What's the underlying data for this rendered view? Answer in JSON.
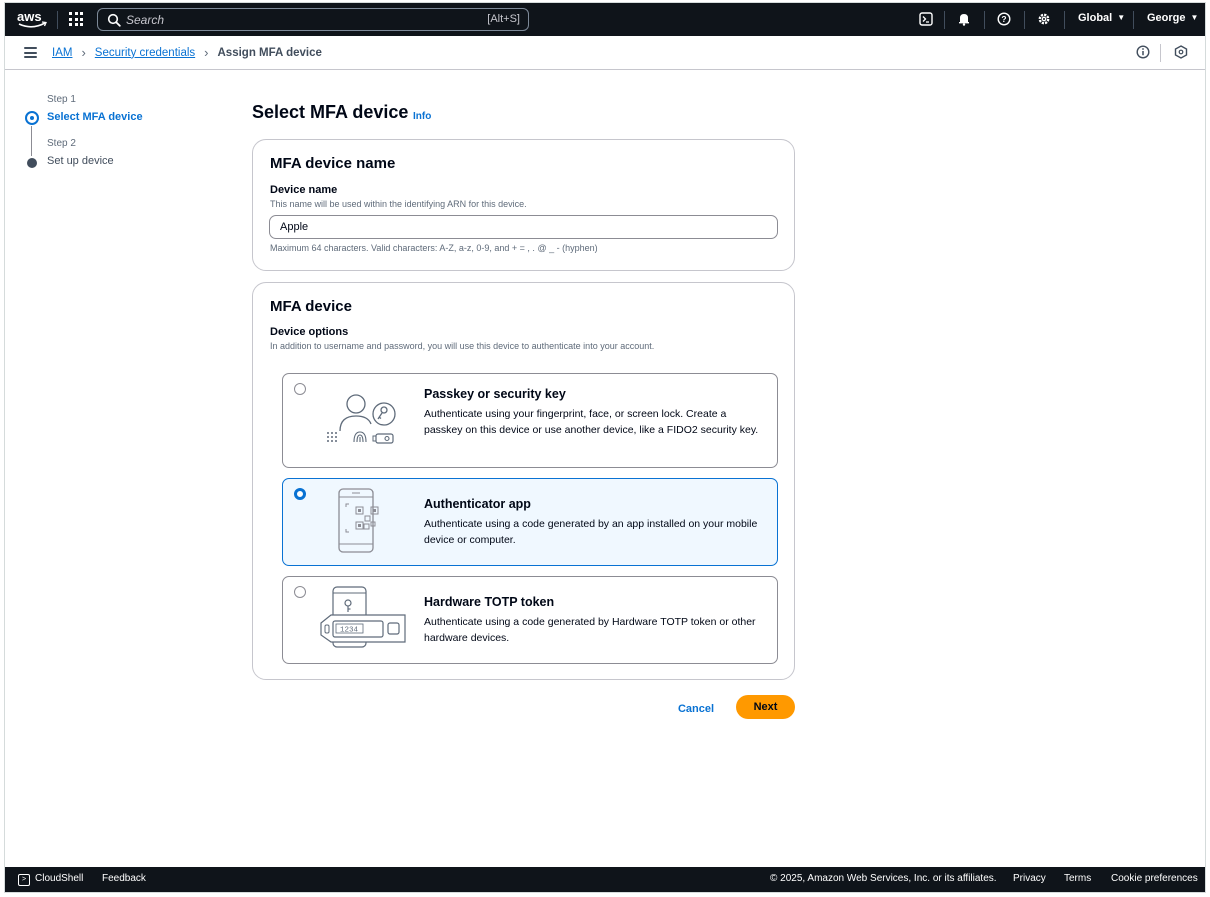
{
  "topnav": {
    "logo_text": "aws",
    "search_placeholder": "Search",
    "search_shortcut": "[Alt+S]",
    "region": "Global",
    "user": "George",
    "icons": [
      "cloudshell-icon",
      "bell-icon",
      "help-icon",
      "gear-icon"
    ]
  },
  "breadcrumb": {
    "items": [
      "IAM",
      "Security credentials"
    ],
    "current": "Assign MFA device"
  },
  "steps": [
    {
      "number": "Step 1",
      "label": "Select MFA device",
      "active": true
    },
    {
      "number": "Step 2",
      "label": "Set up device",
      "active": false
    }
  ],
  "page": {
    "title": "Select MFA device",
    "info": "Info"
  },
  "name_section": {
    "title": "MFA device name",
    "label": "Device name",
    "description": "This name will be used within the identifying ARN for this device.",
    "value": "Apple",
    "constraint": "Maximum 64 characters. Valid characters: A-Z, a-z, 0-9, and + = , . @ _ - (hyphen)"
  },
  "device_section": {
    "title": "MFA device",
    "label": "Device options",
    "description": "In addition to username and password, you will use this device to authenticate into your account.",
    "options": [
      {
        "title": "Passkey or security key",
        "description": "Authenticate using your fingerprint, face, or screen lock. Create a passkey on this device or use another device, like a FIDO2 security key.",
        "selected": false
      },
      {
        "title": "Authenticator app",
        "description": "Authenticate using a code generated by an app installed on your mobile device or computer.",
        "selected": true
      },
      {
        "title": "Hardware TOTP token",
        "description": "Authenticate using a code generated by Hardware TOTP token or other hardware devices.",
        "selected": false
      }
    ],
    "token_display": "1234"
  },
  "actions": {
    "cancel": "Cancel",
    "next": "Next"
  },
  "footer": {
    "cloudshell": "CloudShell",
    "feedback": "Feedback",
    "copyright": "© 2025, Amazon Web Services, Inc. or its affiliates.",
    "privacy": "Privacy",
    "terms": "Terms",
    "cookie": "Cookie preferences"
  },
  "colors": {
    "nav_bg": "#0f141a",
    "link": "#0972d3",
    "primary_button": "#ff9900",
    "selected_bg": "#f0f8ff"
  }
}
